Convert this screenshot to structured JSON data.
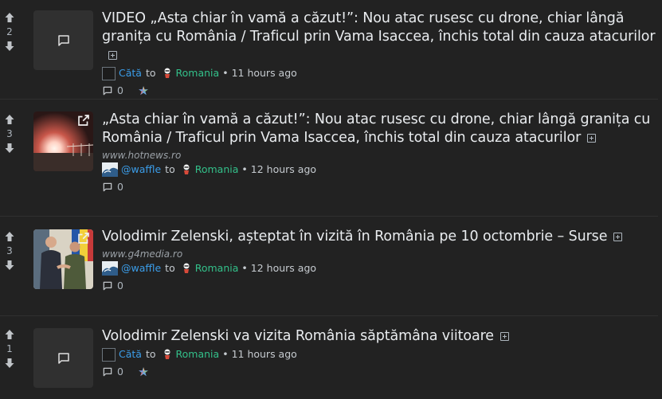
{
  "posts": [
    {
      "score": "2",
      "title": "VIDEO „Asta chiar în vamă a căzut!”: Nou atac rusesc cu drone, chiar lângă granița cu România / Traficul prin Vama Isaccea, închis total din cauza atacurilor",
      "domain": "",
      "user": "Cătă",
      "to": "to",
      "community": "Romania",
      "dot": "•",
      "time": "11 hours ago",
      "comments": "0"
    },
    {
      "score": "3",
      "title": "„Asta chiar în vamă a căzut!”: Nou atac rusesc cu drone, chiar lângă granița cu România / Traficul prin Vama Isaccea, închis total din cauza atacurilor",
      "domain": "www.hotnews.ro",
      "user": "@waffle",
      "to": "to",
      "community": "Romania",
      "dot": "•",
      "time": "12 hours ago",
      "comments": "0"
    },
    {
      "score": "3",
      "title": "Volodimir Zelenski, așteptat în vizită în România pe 10 octombrie – Surse",
      "domain": "www.g4media.ro",
      "user": "@waffle",
      "to": "to",
      "community": "Romania",
      "dot": "•",
      "time": "12 hours ago",
      "comments": "0"
    },
    {
      "score": "1",
      "title": "Volodimir Zelenski va vizita România săptămâna viitoare",
      "domain": "",
      "user": "Cătă",
      "to": "to",
      "community": "Romania",
      "dot": "•",
      "time": "11 hours ago",
      "comments": "0"
    }
  ],
  "icons": {
    "upvote": "arrow-up-icon",
    "downvote": "arrow-down-icon",
    "comment": "message-square-icon",
    "external": "external-link-icon",
    "expand": "plus-square-icon",
    "community": "romania-community-icon",
    "crosspost": "colorful-star-icon"
  },
  "colors": {
    "background": "#222222",
    "user_link": "#3b9de9",
    "community_link": "#33c08a",
    "title": "#e9ecef"
  }
}
